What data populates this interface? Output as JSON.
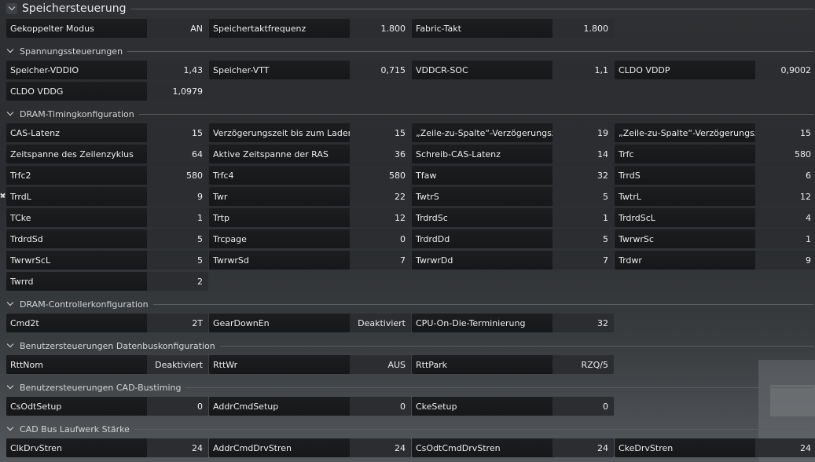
{
  "sections": [
    {
      "title": "Speichersteuerung",
      "big": true,
      "rows": [
        [
          [
            "Gekoppelter Modus",
            "AN"
          ],
          [
            "Speichertaktfrequenz",
            "1.800"
          ],
          [
            "Fabric-Takt",
            "1.800"
          ]
        ]
      ]
    },
    {
      "title": "Spannungssteuerungen",
      "rows": [
        [
          [
            "Speicher-VDDIO",
            "1,43"
          ],
          [
            "Speicher-VTT",
            "0,715"
          ],
          [
            "VDDCR-SOC",
            "1,1"
          ],
          [
            "CLDO VDDP",
            "0,9002"
          ]
        ],
        [
          [
            "CLDO VDDG",
            "1,0979"
          ]
        ]
      ]
    },
    {
      "title": "DRAM-Timingkonfiguration",
      "rows": [
        [
          [
            "CAS-Latenz",
            "15"
          ],
          [
            "Verzögerungszeit bis zum Laden ...",
            "15"
          ],
          [
            "„Zeile-zu-Spalte“-Verzögerungsze...",
            "19"
          ],
          [
            "„Zeile-zu-Spalte“-Verzögerungsze...",
            "15"
          ]
        ],
        [
          [
            "Zeitspanne des Zeilenzyklus",
            "64"
          ],
          [
            "Aktive Zeitspanne der RAS",
            "36"
          ],
          [
            "Schreib-CAS-Latenz",
            "14"
          ],
          [
            "Trfc",
            "580"
          ]
        ],
        [
          [
            "Trfc2",
            "580"
          ],
          [
            "Trfc4",
            "580"
          ],
          [
            "Tfaw",
            "32"
          ],
          [
            "TrrdS",
            "6"
          ]
        ],
        [
          [
            "TrrdL",
            "9"
          ],
          [
            "Twr",
            "22"
          ],
          [
            "TwtrS",
            "5"
          ],
          [
            "TwtrL",
            "12"
          ]
        ],
        [
          [
            "TCke",
            "1"
          ],
          [
            "Trtp",
            "12"
          ],
          [
            "TrdrdSc",
            "1"
          ],
          [
            "TrdrdScL",
            "4"
          ]
        ],
        [
          [
            "TrdrdSd",
            "5"
          ],
          [
            "Trcpage",
            "0"
          ],
          [
            "TrdrdDd",
            "5"
          ],
          [
            "TwrwrSc",
            "1"
          ]
        ],
        [
          [
            "TwrwrScL",
            "5"
          ],
          [
            "TwrwrSd",
            "7"
          ],
          [
            "TwrwrDd",
            "7"
          ],
          [
            "Trdwr",
            "9"
          ]
        ],
        [
          [
            "Twrrd",
            "2"
          ]
        ]
      ]
    },
    {
      "title": "DRAM-Controllerkonfiguration",
      "rows": [
        [
          [
            "Cmd2t",
            "2T"
          ],
          [
            "GearDownEn",
            "Deaktiviert"
          ],
          [
            "CPU-On-Die-Terminierung",
            "32"
          ]
        ]
      ]
    },
    {
      "title": "Benutzersteuerungen Datenbuskonfiguration",
      "rows": [
        [
          [
            "RttNom",
            "Deaktiviert"
          ],
          [
            "RttWr",
            "AUS"
          ],
          [
            "RttPark",
            "RZQ/5"
          ]
        ]
      ]
    },
    {
      "title": "Benutzersteuerungen CAD-Bustiming",
      "rows": [
        [
          [
            "CsOdtSetup",
            "0"
          ],
          [
            "AddrCmdSetup",
            "0"
          ],
          [
            "CkeSetup",
            "0"
          ]
        ]
      ]
    },
    {
      "title": "CAD Bus Laufwerk Stärke",
      "rows": [
        [
          [
            "ClkDrvStren",
            "24"
          ],
          [
            "AddrCmdDrvStren",
            "24"
          ],
          [
            "CsOdtCmdDrvStren",
            "24"
          ],
          [
            "CkeDrvStren",
            "24"
          ]
        ]
      ]
    }
  ]
}
